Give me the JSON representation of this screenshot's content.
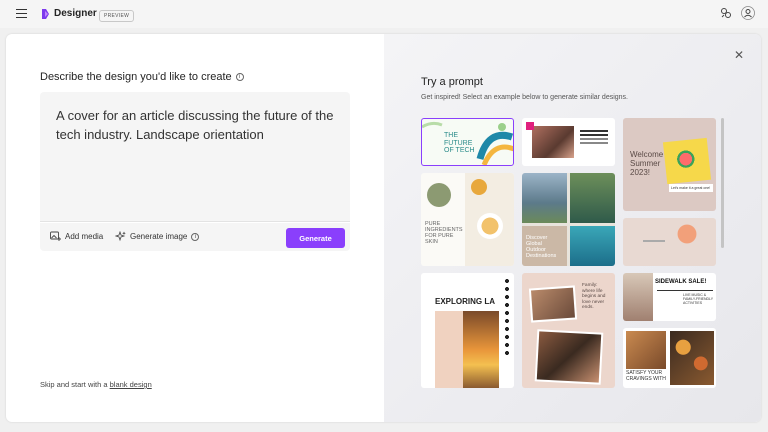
{
  "topbar": {
    "brand": "Designer",
    "badge": "PREVIEW"
  },
  "left": {
    "heading": "Describe the design you'd like to create",
    "prompt_text": "A cover for an article discussing the future of the tech industry. Landscape orientation",
    "tools": {
      "add_media": "Add media",
      "generate_image": "Generate image"
    },
    "generate_label": "Generate",
    "skip_prefix": "Skip and start with a ",
    "skip_link": "blank design"
  },
  "right": {
    "title": "Try a prompt",
    "subtitle": "Get inspired! Select an example below to generate similar designs.",
    "tiles": {
      "future_tech": {
        "line1": "THE",
        "line2": "FUTURE",
        "line3": "OF TECH"
      },
      "summer": {
        "line1": "Welcome",
        "line2": "Summer",
        "line3": "2023!",
        "caption": "Let's make it a great one!"
      },
      "ingredients": {
        "line1": "PURE",
        "line2": "INGREDIENTS",
        "line3": "FOR PURE",
        "line4": "SKIN"
      },
      "discover": {
        "line1": "Discover",
        "line2": "Global",
        "line3": "Outdoor",
        "line4": "Destinations"
      },
      "exploring": {
        "title": "EXPLORING LA"
      },
      "family": {
        "line1": "Family:",
        "line2": "where life",
        "line3": "begins and",
        "line4": "love never",
        "line5": "ends."
      },
      "sidewalk": {
        "title": "SIDEWALK SALE!",
        "sub1": "LIVE MUSIC &",
        "sub2": "FAMILY-FRIENDLY",
        "sub3": "ACTIVITIES"
      },
      "cravings": {
        "line1": "SATISFY YOUR",
        "line2": "CRAVINGS WITH"
      }
    }
  },
  "colors": {
    "accent": "#8a3ffc"
  }
}
